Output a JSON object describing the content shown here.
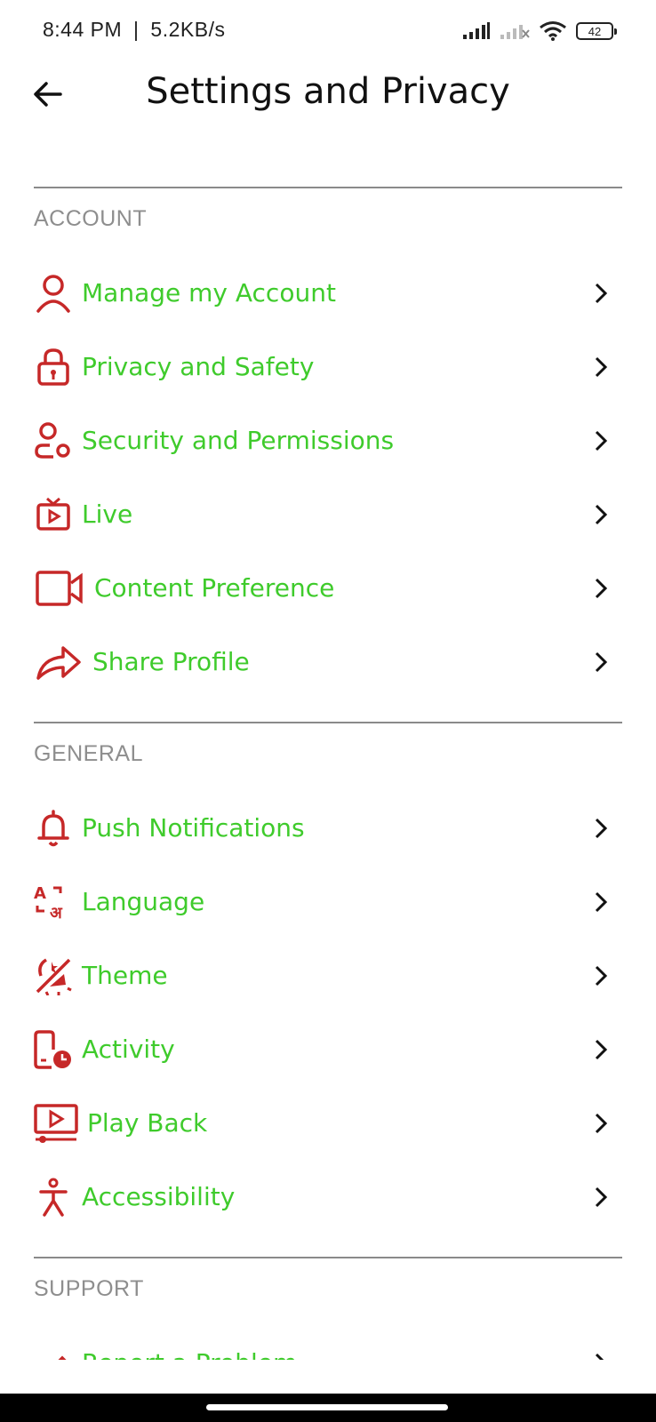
{
  "status_bar": {
    "time": "8:44 PM",
    "speed": "5.2KB/s",
    "battery": "42",
    "icons": [
      "signal-icon",
      "signal-no-sim-icon",
      "wifi-icon",
      "battery-icon"
    ]
  },
  "header": {
    "title": "Settings and Privacy",
    "back_icon": "arrow-left-icon"
  },
  "colors": {
    "icon": "#c62828",
    "label": "#3fcb2c",
    "section_title": "#8e8e8e"
  },
  "sections": [
    {
      "title": "ACCOUNT",
      "items": [
        {
          "label": "Manage my Account",
          "icon": "user-icon"
        },
        {
          "label": "Privacy and Safety",
          "icon": "lock-icon"
        },
        {
          "label": "Security and Permissions",
          "icon": "user-shield-icon"
        },
        {
          "label": "Live",
          "icon": "tv-icon"
        },
        {
          "label": "Content Preference",
          "icon": "video-camera-icon"
        },
        {
          "label": "Share Profile",
          "icon": "share-arrow-icon"
        }
      ]
    },
    {
      "title": "GENERAL",
      "items": [
        {
          "label": "Push Notifications",
          "icon": "bell-icon"
        },
        {
          "label": "Language",
          "icon": "translate-icon"
        },
        {
          "label": "Theme",
          "icon": "theme-icon"
        },
        {
          "label": "Activity",
          "icon": "phone-clock-icon"
        },
        {
          "label": "Play Back",
          "icon": "playback-icon"
        },
        {
          "label": "Accessibility",
          "icon": "accessibility-icon"
        }
      ]
    },
    {
      "title": "SUPPORT",
      "items": [
        {
          "label": "Report a Problem",
          "icon": "pencil-icon"
        }
      ]
    }
  ]
}
